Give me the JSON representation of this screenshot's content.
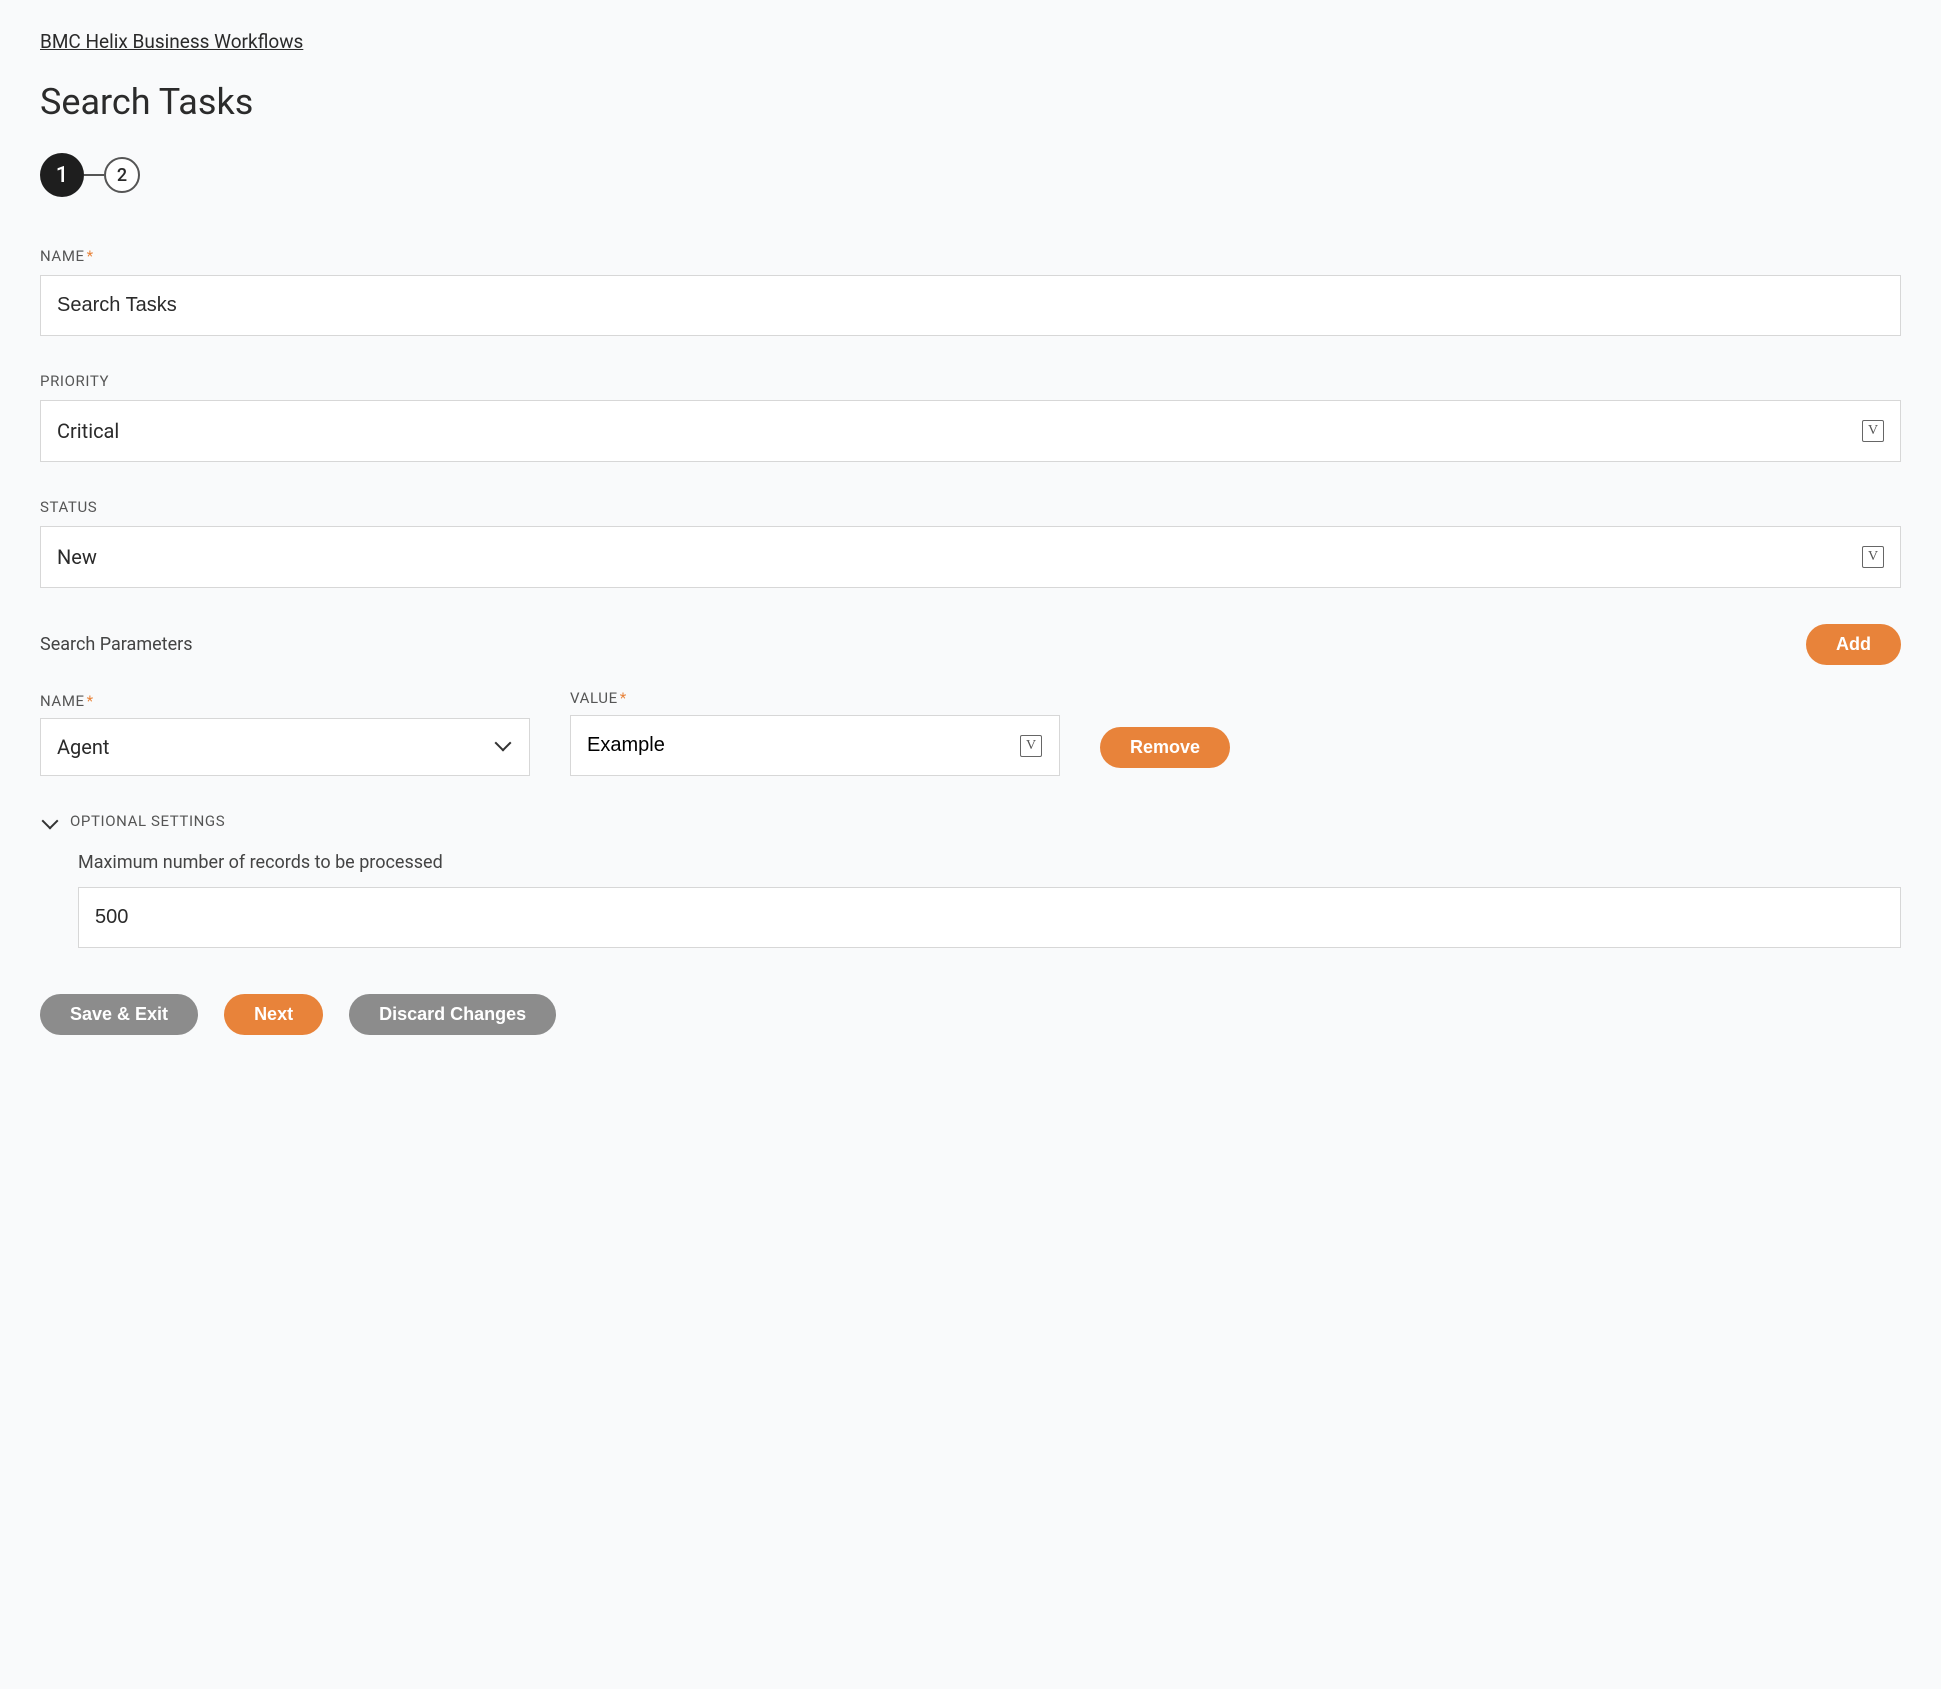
{
  "breadcrumb": "BMC Helix Business Workflows",
  "title": "Search Tasks",
  "stepper": {
    "current": "1",
    "next": "2"
  },
  "fields": {
    "name_label": "NAME",
    "name_value": "Search Tasks",
    "priority_label": "PRIORITY",
    "priority_value": "Critical",
    "status_label": "STATUS",
    "status_value": "New"
  },
  "search_params": {
    "section_label": "Search Parameters",
    "add_label": "Add",
    "name_label": "NAME",
    "name_value": "Agent",
    "value_label": "VALUE",
    "value_value": "Example",
    "remove_label": "Remove"
  },
  "optional": {
    "section_label": "OPTIONAL SETTINGS",
    "max_label": "Maximum number of records to be processed",
    "max_value": "500"
  },
  "actions": {
    "save_exit": "Save & Exit",
    "next": "Next",
    "discard": "Discard Changes"
  }
}
